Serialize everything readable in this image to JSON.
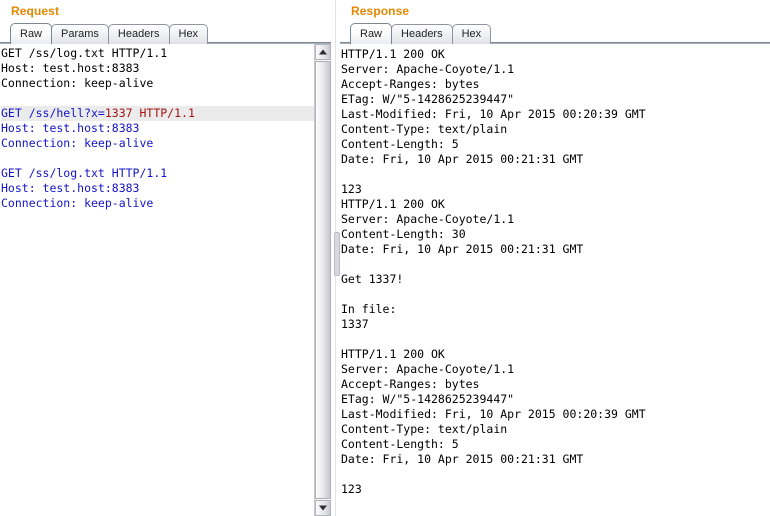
{
  "request": {
    "title": "Request",
    "tabs": [
      {
        "label": "Raw",
        "selected": true
      },
      {
        "label": "Params",
        "selected": false
      },
      {
        "label": "Headers",
        "selected": false
      },
      {
        "label": "Hex",
        "selected": false
      }
    ],
    "scrollbar": {
      "up_arrow_icon": "triangle-up-icon",
      "down_arrow_icon": "triangle-down-icon"
    },
    "lines": [
      {
        "highlight": false,
        "segments": [
          {
            "text": "GET /ss/log.txt HTTP/1.1",
            "color": "plain"
          }
        ]
      },
      {
        "highlight": false,
        "segments": [
          {
            "text": "Host: test.host:8383",
            "color": "plain"
          }
        ]
      },
      {
        "highlight": false,
        "segments": [
          {
            "text": "Connection: keep-alive",
            "color": "plain"
          }
        ]
      },
      {
        "highlight": false,
        "segments": [
          {
            "text": "",
            "color": "plain"
          }
        ]
      },
      {
        "highlight": true,
        "segments": [
          {
            "text": "GET /ss/hell?x=",
            "color": "blue"
          },
          {
            "text": "1337 HTTP/1.1",
            "color": "red"
          }
        ]
      },
      {
        "highlight": false,
        "segments": [
          {
            "text": "Host: test.host:8383",
            "color": "blue"
          }
        ]
      },
      {
        "highlight": false,
        "segments": [
          {
            "text": "Connection: keep-alive",
            "color": "blue"
          }
        ]
      },
      {
        "highlight": false,
        "segments": [
          {
            "text": "",
            "color": "plain"
          }
        ]
      },
      {
        "highlight": false,
        "segments": [
          {
            "text": "GET /ss/log.txt HTTP/1.1",
            "color": "blue"
          }
        ]
      },
      {
        "highlight": false,
        "segments": [
          {
            "text": "Host: test.host:8383",
            "color": "blue"
          }
        ]
      },
      {
        "highlight": false,
        "segments": [
          {
            "text": "Connection: keep-alive",
            "color": "blue"
          }
        ]
      }
    ]
  },
  "response": {
    "title": "Response",
    "tabs": [
      {
        "label": "Raw",
        "selected": true
      },
      {
        "label": "Headers",
        "selected": false
      },
      {
        "label": "Hex",
        "selected": false
      }
    ],
    "lines": [
      "HTTP/1.1 200 OK",
      "Server: Apache-Coyote/1.1",
      "Accept-Ranges: bytes",
      "ETag: W/\"5-1428625239447\"",
      "Last-Modified: Fri, 10 Apr 2015 00:20:39 GMT",
      "Content-Type: text/plain",
      "Content-Length: 5",
      "Date: Fri, 10 Apr 2015 00:21:31 GMT",
      "",
      "123",
      "HTTP/1.1 200 OK",
      "Server: Apache-Coyote/1.1",
      "Content-Length: 30",
      "Date: Fri, 10 Apr 2015 00:21:31 GMT",
      "",
      "Get 1337!",
      "",
      "In file:",
      "1337",
      "",
      "HTTP/1.1 200 OK",
      "Server: Apache-Coyote/1.1",
      "Accept-Ranges: bytes",
      "ETag: W/\"5-1428625239447\"",
      "Last-Modified: Fri, 10 Apr 2015 00:20:39 GMT",
      "Content-Type: text/plain",
      "Content-Length: 5",
      "Date: Fri, 10 Apr 2015 00:21:31 GMT",
      "",
      "123"
    ]
  },
  "colors": {
    "panel_title": "#e58700",
    "text_plain": "#000000",
    "text_blue": "#1414c8",
    "text_red": "#a31414",
    "highlight_row": "#ebebeb"
  }
}
